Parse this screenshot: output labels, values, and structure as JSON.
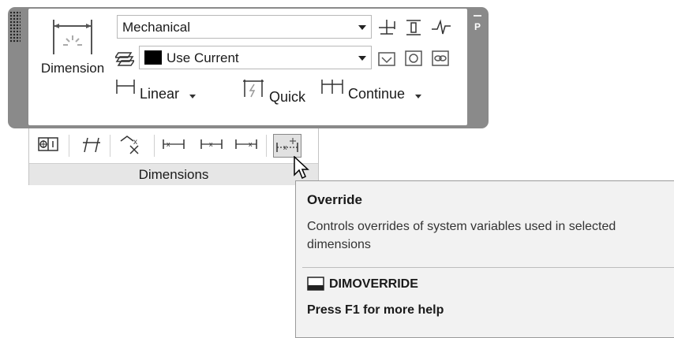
{
  "panel": {
    "dimension_button_label": "Dimension",
    "dim_style": {
      "selected": "Mechanical"
    },
    "layer": {
      "selected": "Use Current",
      "swatch_color": "#000000"
    },
    "row3": {
      "linear_label": "Linear",
      "quick_label": "Quick",
      "continue_label": "Continue"
    }
  },
  "ribbon": {
    "panel_title": "Dimensions"
  },
  "tooltip": {
    "title": "Override",
    "description": "Controls overrides of system variables used in selected dimensions",
    "command": "DIMOVERRIDE",
    "help": "Press F1 for more help"
  },
  "icons": [
    "dimension-icon",
    "layer-icon",
    "baseline-icon",
    "space-icon",
    "jogline-icon",
    "inspect-icon",
    "update-icon",
    "reassociate-icon",
    "linear-dim-icon",
    "quick-dim-icon",
    "continue-dim-icon",
    "tolerance-icon",
    "oblique-icon",
    "text-angle-icon",
    "justify-left-icon",
    "justify-center-icon",
    "justify-right-icon",
    "override-icon",
    "mouse-cursor-icon",
    "command-icon"
  ]
}
